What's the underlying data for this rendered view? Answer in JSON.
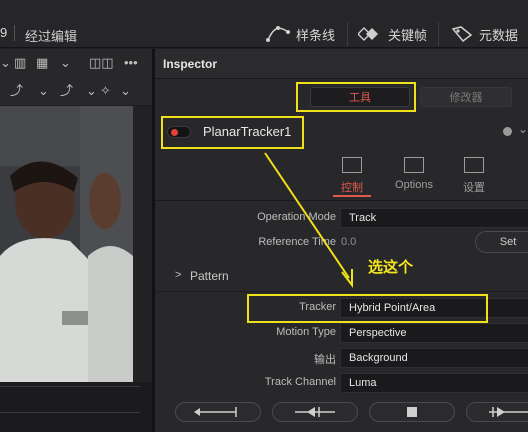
{
  "topbar": {
    "left_number": "9",
    "title": "经过编辑",
    "spline_label": "样条线",
    "keyframes_label": "关键帧",
    "metadata_label": "元数据"
  },
  "inspector": {
    "title": "Inspector",
    "segment_tools": "工具",
    "segment_modifiers": "修改器",
    "node_name": "PlanarTracker1",
    "tabs": {
      "controls": "控制",
      "options": "Options",
      "settings": "设置"
    },
    "params": {
      "operation_mode_label": "Operation Mode",
      "operation_mode_value": "Track",
      "reference_time_label": "Reference Time",
      "reference_time_value": "0.0",
      "set_button": "Set",
      "pattern_label": "Pattern",
      "tracker_label": "Tracker",
      "tracker_value": "Hybrid Point/Area",
      "motion_type_label": "Motion Type",
      "motion_type_value": "Perspective",
      "output_label": "输出",
      "output_value": "Background",
      "track_channel_label": "Track Channel",
      "track_channel_value": "Luma"
    }
  },
  "annotation": {
    "label": "选这个",
    "color": "#f0e01a"
  },
  "colors": {
    "accent": "#e05a4b",
    "panel": "#28282b"
  }
}
